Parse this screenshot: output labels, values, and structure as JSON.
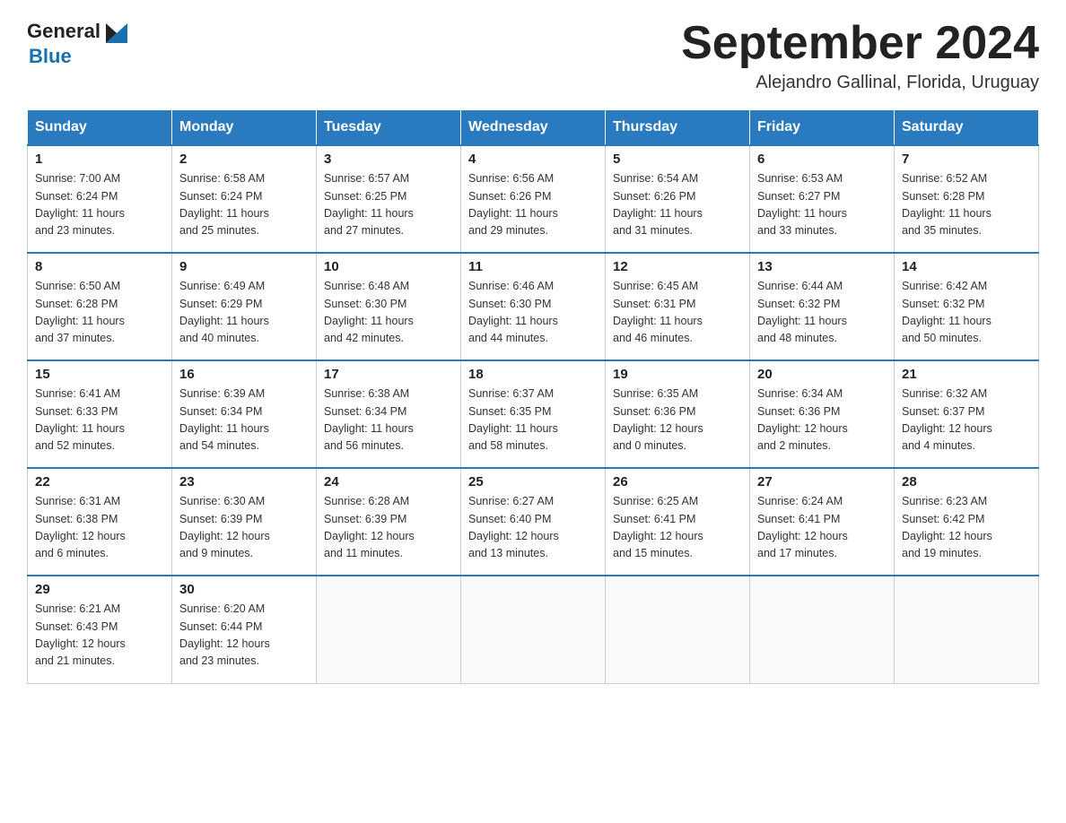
{
  "logo": {
    "line1_black": "General",
    "line1_icon": "▶",
    "line2_blue": "Blue"
  },
  "title": "September 2024",
  "subtitle": "Alejandro Gallinal, Florida, Uruguay",
  "days_of_week": [
    "Sunday",
    "Monday",
    "Tuesday",
    "Wednesday",
    "Thursday",
    "Friday",
    "Saturday"
  ],
  "weeks": [
    [
      {
        "day": "1",
        "sunrise": "7:00 AM",
        "sunset": "6:24 PM",
        "daylight": "11 hours and 23 minutes."
      },
      {
        "day": "2",
        "sunrise": "6:58 AM",
        "sunset": "6:24 PM",
        "daylight": "11 hours and 25 minutes."
      },
      {
        "day": "3",
        "sunrise": "6:57 AM",
        "sunset": "6:25 PM",
        "daylight": "11 hours and 27 minutes."
      },
      {
        "day": "4",
        "sunrise": "6:56 AM",
        "sunset": "6:26 PM",
        "daylight": "11 hours and 29 minutes."
      },
      {
        "day": "5",
        "sunrise": "6:54 AM",
        "sunset": "6:26 PM",
        "daylight": "11 hours and 31 minutes."
      },
      {
        "day": "6",
        "sunrise": "6:53 AM",
        "sunset": "6:27 PM",
        "daylight": "11 hours and 33 minutes."
      },
      {
        "day": "7",
        "sunrise": "6:52 AM",
        "sunset": "6:28 PM",
        "daylight": "11 hours and 35 minutes."
      }
    ],
    [
      {
        "day": "8",
        "sunrise": "6:50 AM",
        "sunset": "6:28 PM",
        "daylight": "11 hours and 37 minutes."
      },
      {
        "day": "9",
        "sunrise": "6:49 AM",
        "sunset": "6:29 PM",
        "daylight": "11 hours and 40 minutes."
      },
      {
        "day": "10",
        "sunrise": "6:48 AM",
        "sunset": "6:30 PM",
        "daylight": "11 hours and 42 minutes."
      },
      {
        "day": "11",
        "sunrise": "6:46 AM",
        "sunset": "6:30 PM",
        "daylight": "11 hours and 44 minutes."
      },
      {
        "day": "12",
        "sunrise": "6:45 AM",
        "sunset": "6:31 PM",
        "daylight": "11 hours and 46 minutes."
      },
      {
        "day": "13",
        "sunrise": "6:44 AM",
        "sunset": "6:32 PM",
        "daylight": "11 hours and 48 minutes."
      },
      {
        "day": "14",
        "sunrise": "6:42 AM",
        "sunset": "6:32 PM",
        "daylight": "11 hours and 50 minutes."
      }
    ],
    [
      {
        "day": "15",
        "sunrise": "6:41 AM",
        "sunset": "6:33 PM",
        "daylight": "11 hours and 52 minutes."
      },
      {
        "day": "16",
        "sunrise": "6:39 AM",
        "sunset": "6:34 PM",
        "daylight": "11 hours and 54 minutes."
      },
      {
        "day": "17",
        "sunrise": "6:38 AM",
        "sunset": "6:34 PM",
        "daylight": "11 hours and 56 minutes."
      },
      {
        "day": "18",
        "sunrise": "6:37 AM",
        "sunset": "6:35 PM",
        "daylight": "11 hours and 58 minutes."
      },
      {
        "day": "19",
        "sunrise": "6:35 AM",
        "sunset": "6:36 PM",
        "daylight": "12 hours and 0 minutes."
      },
      {
        "day": "20",
        "sunrise": "6:34 AM",
        "sunset": "6:36 PM",
        "daylight": "12 hours and 2 minutes."
      },
      {
        "day": "21",
        "sunrise": "6:32 AM",
        "sunset": "6:37 PM",
        "daylight": "12 hours and 4 minutes."
      }
    ],
    [
      {
        "day": "22",
        "sunrise": "6:31 AM",
        "sunset": "6:38 PM",
        "daylight": "12 hours and 6 minutes."
      },
      {
        "day": "23",
        "sunrise": "6:30 AM",
        "sunset": "6:39 PM",
        "daylight": "12 hours and 9 minutes."
      },
      {
        "day": "24",
        "sunrise": "6:28 AM",
        "sunset": "6:39 PM",
        "daylight": "12 hours and 11 minutes."
      },
      {
        "day": "25",
        "sunrise": "6:27 AM",
        "sunset": "6:40 PM",
        "daylight": "12 hours and 13 minutes."
      },
      {
        "day": "26",
        "sunrise": "6:25 AM",
        "sunset": "6:41 PM",
        "daylight": "12 hours and 15 minutes."
      },
      {
        "day": "27",
        "sunrise": "6:24 AM",
        "sunset": "6:41 PM",
        "daylight": "12 hours and 17 minutes."
      },
      {
        "day": "28",
        "sunrise": "6:23 AM",
        "sunset": "6:42 PM",
        "daylight": "12 hours and 19 minutes."
      }
    ],
    [
      {
        "day": "29",
        "sunrise": "6:21 AM",
        "sunset": "6:43 PM",
        "daylight": "12 hours and 21 minutes."
      },
      {
        "day": "30",
        "sunrise": "6:20 AM",
        "sunset": "6:44 PM",
        "daylight": "12 hours and 23 minutes."
      },
      null,
      null,
      null,
      null,
      null
    ]
  ],
  "labels": {
    "sunrise": "Sunrise:",
    "sunset": "Sunset:",
    "daylight": "Daylight:"
  }
}
